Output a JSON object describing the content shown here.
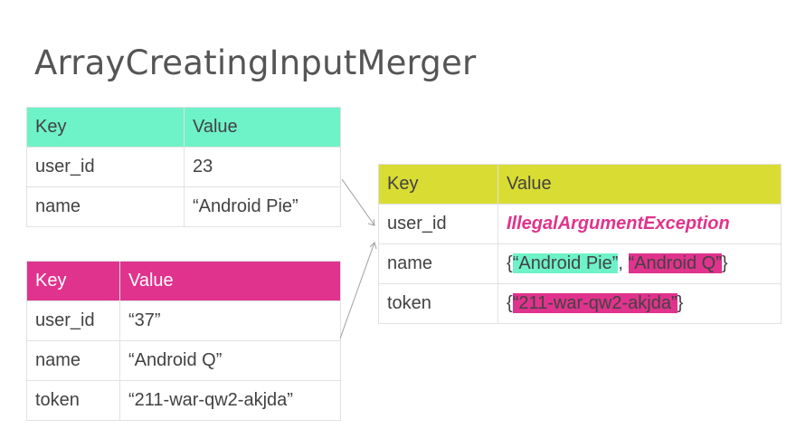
{
  "title": "ArrayCreatingInputMerger",
  "colors": {
    "input1_header": "#6ef2c8",
    "input2_header": "#e0338d",
    "output_header": "#d9dc33",
    "exception_text": "#e0338d"
  },
  "input1": {
    "header": {
      "key": "Key",
      "value": "Value"
    },
    "rows": [
      {
        "key": "user_id",
        "value": "23"
      },
      {
        "key": "name",
        "value": "“Android Pie”"
      }
    ]
  },
  "input2": {
    "header": {
      "key": "Key",
      "value": "Value"
    },
    "rows": [
      {
        "key": "user_id",
        "value": "“37”"
      },
      {
        "key": "name",
        "value": "“Android Q”"
      },
      {
        "key": "token",
        "value": "“211-war-qw2-akjda”"
      }
    ]
  },
  "output": {
    "header": {
      "key": "Key",
      "value": "Value"
    },
    "rows": [
      {
        "key": "user_id",
        "value": "IllegalArgumentException"
      },
      {
        "key": "name",
        "open": "{",
        "part1": "“Android Pie”",
        "sep": ", ",
        "part2": "“Android Q”",
        "close": "}"
      },
      {
        "key": "token",
        "open": "{",
        "part1": "“211-war-qw2-akjda”",
        "close": "}"
      }
    ]
  }
}
